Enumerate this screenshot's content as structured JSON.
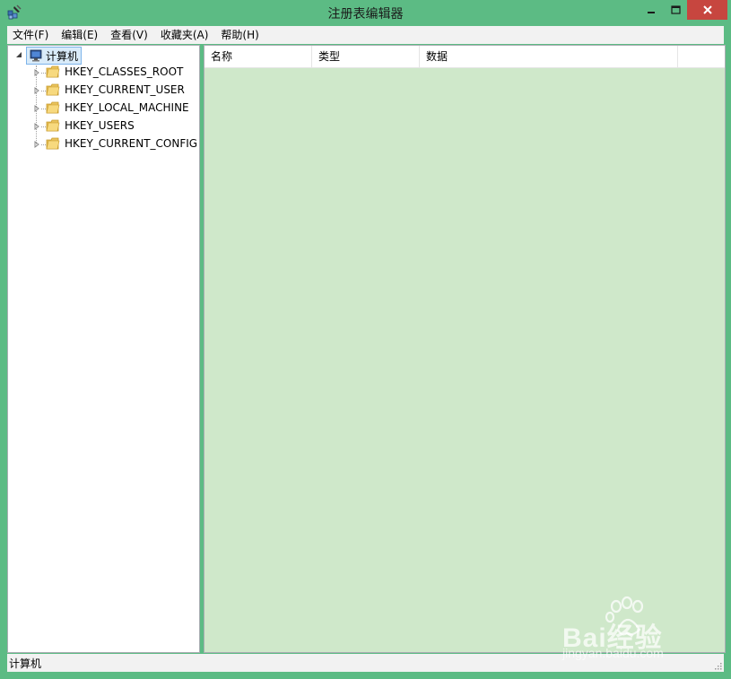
{
  "window": {
    "title": "注册表编辑器"
  },
  "menu": {
    "items": [
      {
        "label": "文件(F)"
      },
      {
        "label": "编辑(E)"
      },
      {
        "label": "查看(V)"
      },
      {
        "label": "收藏夹(A)"
      },
      {
        "label": "帮助(H)"
      }
    ]
  },
  "tree": {
    "root_label": "计算机",
    "keys": [
      {
        "label": "HKEY_CLASSES_ROOT"
      },
      {
        "label": "HKEY_CURRENT_USER"
      },
      {
        "label": "HKEY_LOCAL_MACHINE"
      },
      {
        "label": "HKEY_USERS"
      },
      {
        "label": "HKEY_CURRENT_CONFIG"
      }
    ]
  },
  "list": {
    "columns": [
      {
        "label": "名称"
      },
      {
        "label": "类型"
      },
      {
        "label": "数据"
      }
    ]
  },
  "status": {
    "text": "计算机"
  },
  "watermark": {
    "brand_text": "Bai经验",
    "url_text": "jingyan.baidu.com"
  },
  "colors": {
    "window_frame": "#5cbb84",
    "data_pane_bg": "#cfe8ca",
    "close_button": "#c7463f",
    "selection_border": "#7eb4ea"
  }
}
